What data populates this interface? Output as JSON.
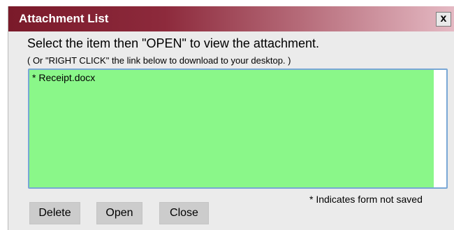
{
  "dialog": {
    "title": "Attachment List",
    "close_symbol": "x",
    "instruction": "Select the item then \"OPEN\" to view the attachment.",
    "sub_instruction": "( Or \"RIGHT CLICK\" the link below to download to your desktop. )",
    "attachments": [
      "* Receipt.docx"
    ],
    "note": "* Indicates form not saved",
    "buttons": {
      "delete": "Delete",
      "open": "Open",
      "close": "Close"
    }
  },
  "colors": {
    "titlebar_start": "#7a1a2a",
    "list_background": "#8af789",
    "list_border": "#79a7d6"
  }
}
